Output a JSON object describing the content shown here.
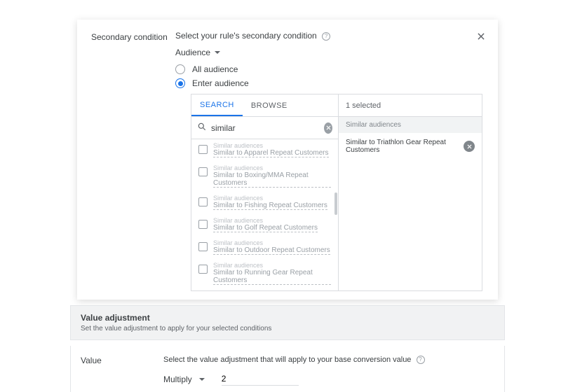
{
  "modal": {
    "label": "Secondary condition",
    "prompt": "Select your rule's secondary condition",
    "dropdown": "Audience",
    "radio_all": "All audience",
    "radio_enter": "Enter audience"
  },
  "picker": {
    "tab_search": "SEARCH",
    "tab_browse": "BROWSE",
    "search_value": "similar",
    "category": "Similar audiences",
    "results": [
      {
        "name": "Similar to  Apparel Repeat Customers",
        "checked": false
      },
      {
        "name": "Similar to  Boxing/MMA Repeat Customers",
        "checked": false
      },
      {
        "name": "Similar to  Fishing Repeat Customers",
        "checked": false
      },
      {
        "name": "Similar to  Golf Repeat Customers",
        "checked": false
      },
      {
        "name": "Similar to  Outdoor Repeat Customers",
        "checked": false
      },
      {
        "name": "Similar to  Running Gear Repeat Customers",
        "checked": false
      },
      {
        "name": "Similar to  Triathlon Gear Repeat Customers",
        "checked": true
      }
    ],
    "selected_count": "1 selected",
    "selected_group": "Similar audiences",
    "selected_item": "Similar to Triathlon Gear Repeat Customers"
  },
  "value_section": {
    "title": "Value adjustment",
    "subtitle": "Set the value adjustment to apply for your selected conditions",
    "row_label": "Value",
    "prompt": "Select the value adjustment that will apply to your base conversion value",
    "operation": "Multiply",
    "amount": "2"
  }
}
